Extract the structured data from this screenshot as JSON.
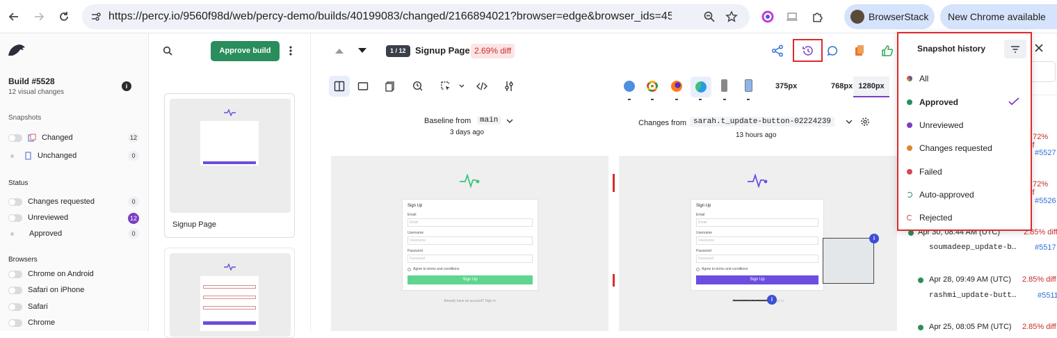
{
  "browser": {
    "url": "https://percy.io/9560f98d/web/percy-demo/builds/40199083/changed/2166894021?browser=edge&browser_ids=45%2C61%...",
    "profile_name": "BrowserStack",
    "update_label": "New Chrome available"
  },
  "sidebar": {
    "build_title": "Build #5528",
    "build_subtitle": "12 visual changes",
    "snapshots_heading": "Snapshots",
    "snapshots": [
      {
        "label": "Changed",
        "count": "12"
      },
      {
        "label": "Unchanged",
        "count": "0"
      }
    ],
    "status_heading": "Status",
    "status": [
      {
        "label": "Changes requested",
        "count": "0"
      },
      {
        "label": "Unreviewed",
        "count": "12"
      },
      {
        "label": "Approved",
        "count": "0"
      }
    ],
    "browsers_heading": "Browsers",
    "browsers": [
      "Chrome on Android",
      "Safari on iPhone",
      "Safari",
      "Chrome"
    ]
  },
  "thumbnails": {
    "approve_label": "Approve build",
    "items": [
      {
        "label": "Signup Page"
      }
    ]
  },
  "main": {
    "snapshot_index": "1 / 12",
    "snapshot_name": "Signup Page",
    "diff_badge": "2.69% diff",
    "widths": [
      "375px",
      "768px",
      "1280px"
    ],
    "baseline_label": "Baseline from",
    "baseline_branch": "main",
    "baseline_time": "3 days ago",
    "changes_label": "Changes from",
    "changes_branch": "sarah.t_update-button-02224239",
    "changes_time": "13 hours ago",
    "form": {
      "title": "Sign Up",
      "email_label": "Email",
      "email_placeholder": "Email",
      "username_label": "Username",
      "username_placeholder": "Username",
      "password_label": "Password",
      "password_placeholder": "Password",
      "terms": "Agree to terms and conditions",
      "submit": "Sign Up",
      "footer": "Already have an account? Sign in"
    },
    "colors": {
      "baseline_button": "#5fd58f",
      "changes_button": "#6b4de0",
      "accent": "#2a8d5c"
    }
  },
  "history": {
    "title": "Snapshot history",
    "options": [
      {
        "label": "All",
        "color": "multicolor"
      },
      {
        "label": "Approved",
        "color": "#2a8d5c",
        "selected": true
      },
      {
        "label": "Unreviewed",
        "color": "#7a3fc4"
      },
      {
        "label": "Changes requested",
        "color": "#d98a2b"
      },
      {
        "label": "Failed",
        "color": "#d94450"
      },
      {
        "label": "Auto-approved",
        "color": "#2a8d5c"
      },
      {
        "label": "Rejected",
        "color": "#d94450"
      }
    ],
    "side_diffs": [
      "2.72% dif",
      "#5527",
      "2.72% dif",
      "#5526"
    ],
    "items": [
      {
        "date": "Apr 30, 08:44 AM (UTC)",
        "diff": "2.85% diff",
        "branch": "soumadeep_update-b…",
        "build": "#5517"
      },
      {
        "date": "Apr 28, 09:49 AM (UTC)",
        "diff": "2.85% diff",
        "branch": "rashmi_update-butt…",
        "build": "#5511"
      },
      {
        "date": "Apr 25, 08:05 PM (UTC)",
        "diff": "2.85% diff"
      }
    ]
  }
}
